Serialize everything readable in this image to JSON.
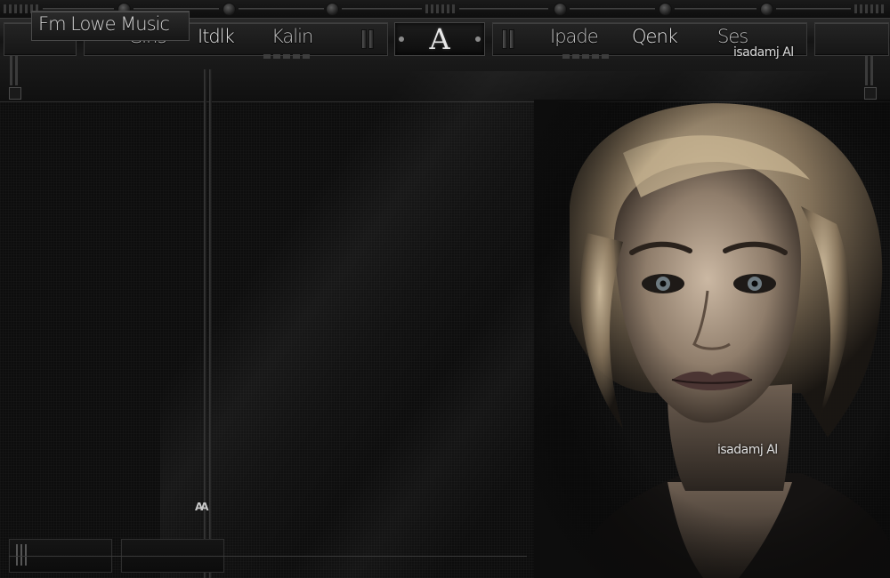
{
  "header": {
    "nav_left": [
      "Giris",
      "Itdlk",
      "Kalin"
    ],
    "nav_right": [
      "Ipade",
      "Qenk",
      "Ses"
    ],
    "logo_letter": "A",
    "signature": "isadamj Al"
  },
  "subheader": {
    "title": "Fm Lowe Music"
  },
  "content": {
    "divider_mark": "AA",
    "photo_signature": "isadamj Al"
  },
  "colors": {
    "background": "#0d0d0d",
    "chrome": "#1c1c1c",
    "text": "#bdbdbd",
    "accent": "#e6e6e6"
  }
}
